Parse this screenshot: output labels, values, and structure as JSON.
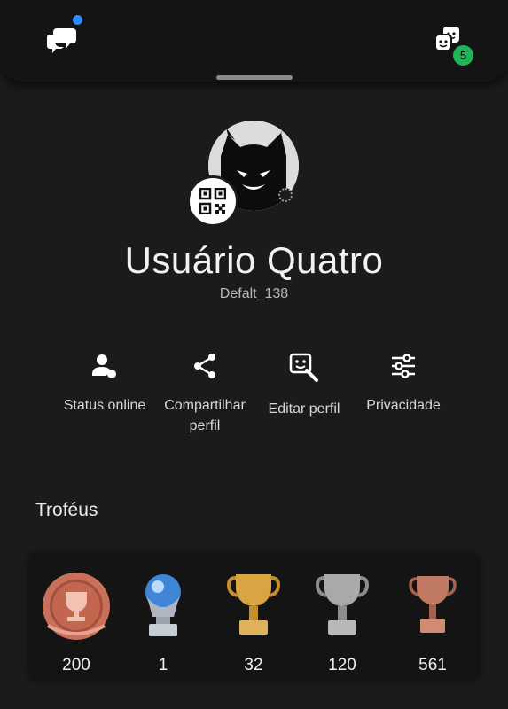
{
  "header": {
    "chat_icon": "chat-bubbles-icon",
    "friends_icon": "friends-icon",
    "friends_badge": "5",
    "colors": {
      "notif_dot": "#2d8cff",
      "badge": "#1fb455"
    }
  },
  "profile": {
    "avatar": "cat-avatar",
    "display_name": "Usuário Quatro",
    "online_id": "Defalt_138"
  },
  "actions": [
    {
      "label": "Status online",
      "icon": "user-status-icon"
    },
    {
      "label": "Compartilhar perfil",
      "icon": "share-icon"
    },
    {
      "label": "Editar perfil",
      "icon": "edit-profile-icon"
    },
    {
      "label": "Privacidade",
      "icon": "sliders-icon"
    }
  ],
  "trophies": {
    "title": "Troféus",
    "items": [
      {
        "type": "level",
        "count": "200",
        "icon": "trophy-level-icon"
      },
      {
        "type": "platinum",
        "count": "1",
        "icon": "platinum-trophy-icon"
      },
      {
        "type": "gold",
        "count": "32",
        "icon": "gold-trophy-icon"
      },
      {
        "type": "silver",
        "count": "120",
        "icon": "silver-trophy-icon"
      },
      {
        "type": "bronze",
        "count": "561",
        "icon": "bronze-trophy-icon"
      }
    ]
  }
}
